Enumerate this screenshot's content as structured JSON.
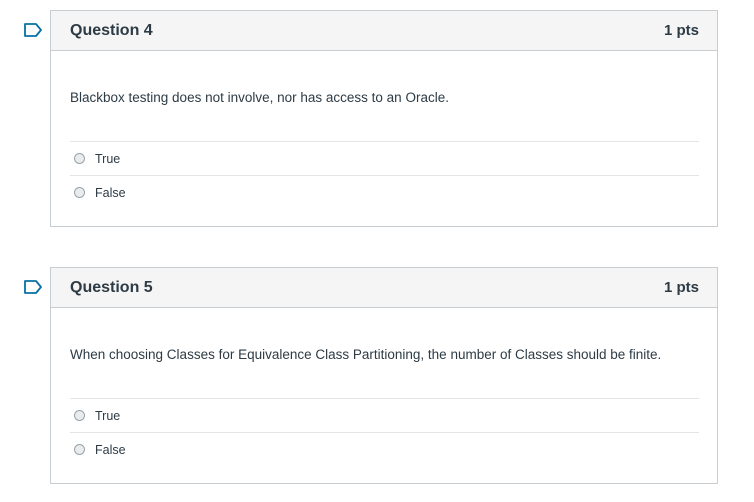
{
  "questions": [
    {
      "title": "Question 4",
      "points": "1 pts",
      "text": "Blackbox testing does not involve, nor has access to an Oracle.",
      "answers": [
        "True",
        "False"
      ]
    },
    {
      "title": "Question 5",
      "points": "1 pts",
      "text": "When choosing Classes for Equivalence Class Partitioning, the number of Classes should be finite.",
      "answers": [
        "True",
        "False"
      ]
    }
  ],
  "colors": {
    "flag": "#0770a3",
    "header_bg": "#f5f5f5",
    "border": "#c7cdd1",
    "text": "#2d3b45"
  },
  "icons": {
    "flag": "bookmark-flag-icon",
    "radio": "radio-button-icon"
  }
}
